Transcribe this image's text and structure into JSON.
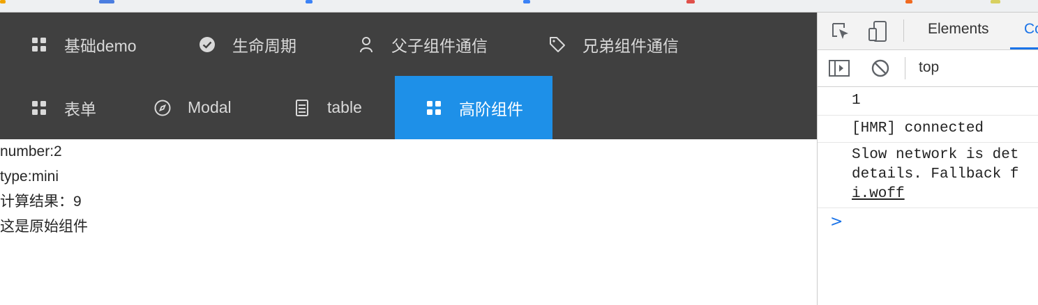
{
  "menu": {
    "items": [
      {
        "label": "基础demo",
        "icon": "grid-icon"
      },
      {
        "label": "生命周期",
        "icon": "check-circle-icon"
      },
      {
        "label": "父子组件通信",
        "icon": "user-icon"
      },
      {
        "label": "兄弟组件通信",
        "icon": "tag-icon"
      },
      {
        "label": "表单",
        "icon": "grid-icon"
      },
      {
        "label": "Modal",
        "icon": "compass-icon"
      },
      {
        "label": "table",
        "icon": "file-icon"
      },
      {
        "label": "高阶组件",
        "icon": "grid-icon",
        "active": true
      }
    ],
    "colors": {
      "background": "#404040",
      "active": "#1e90e8",
      "text": "#d9d9d9"
    }
  },
  "content": {
    "lines": [
      "number:2",
      "type:mini",
      "计算结果：9",
      "这是原始组件"
    ]
  },
  "devtools": {
    "tabs": [
      "Elements",
      "Co"
    ],
    "context": "top",
    "console": {
      "messages": [
        "1",
        "[HMR] connected",
        "Slow network is det",
        "details. Fallback f",
        "i.woff"
      ],
      "prompt": ">"
    }
  }
}
